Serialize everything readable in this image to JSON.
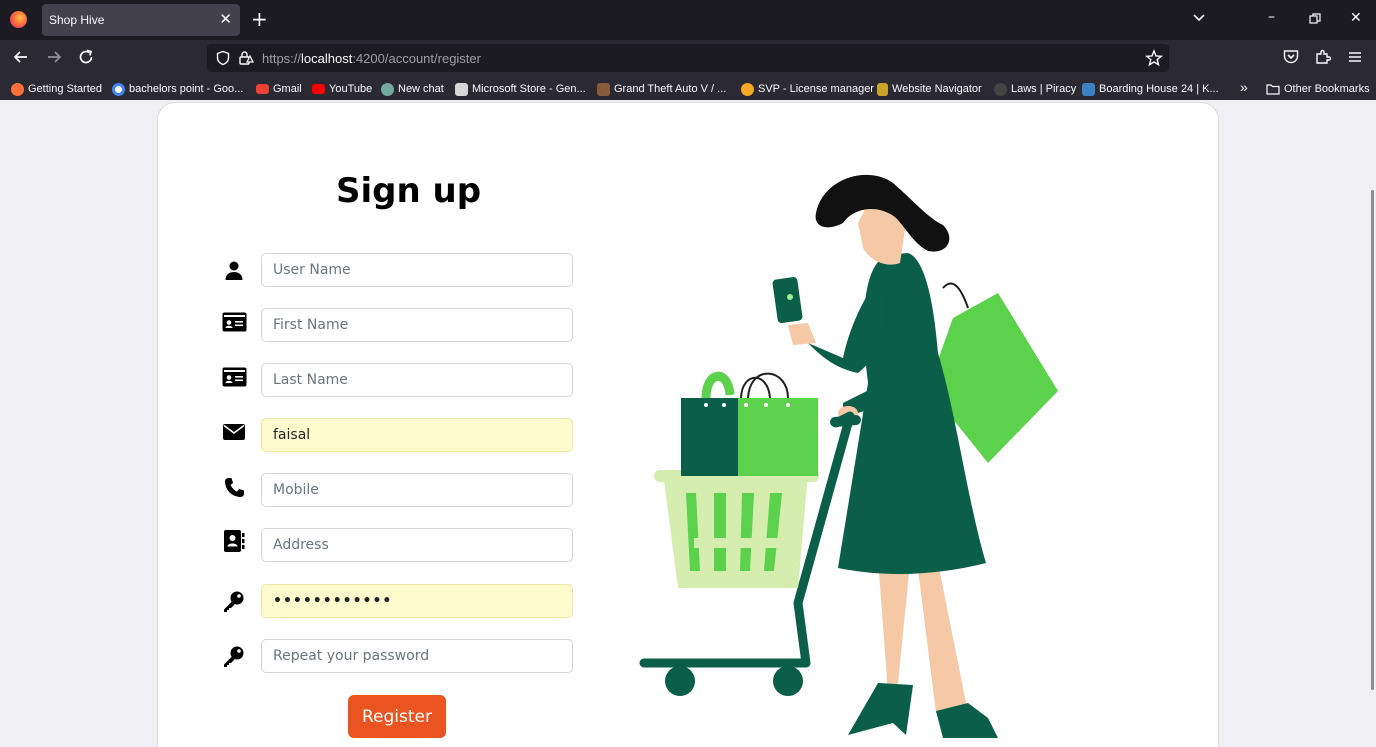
{
  "browser": {
    "tab_title": "Shop Hive",
    "url_prefix": "https://",
    "url_host": "localhost",
    "url_rest": ":4200/account/register"
  },
  "bookmarks": [
    {
      "label": "Getting Started",
      "color": "#ff7139"
    },
    {
      "label": "bachelors point - Goo...",
      "color": "#4285f4"
    },
    {
      "label": "Gmail",
      "color": "#ea4335"
    },
    {
      "label": "YouTube",
      "color": "#ff0000"
    },
    {
      "label": "New chat",
      "color": "#74aa9c"
    },
    {
      "label": "Microsoft Store - Gen...",
      "color": "#d6d6d6"
    },
    {
      "label": "Grand Theft Auto V / ...",
      "color": "#8a5a3c"
    },
    {
      "label": "SVP - License manager",
      "color": "#f4a825"
    },
    {
      "label": "Website Navigator",
      "color": "#c9a227"
    },
    {
      "label": "Laws | Piracy",
      "color": "#444444"
    },
    {
      "label": "Boarding House 24 | K...",
      "color": "#3b82c4"
    }
  ],
  "other_bookmarks": "Other Bookmarks",
  "form": {
    "title": "Sign up",
    "fields": [
      {
        "icon": "user-icon",
        "placeholder": "User Name",
        "value": ""
      },
      {
        "icon": "id-card-icon",
        "placeholder": "First Name",
        "value": ""
      },
      {
        "icon": "id-card-icon",
        "placeholder": "Last Name",
        "value": ""
      },
      {
        "icon": "envelope-icon",
        "placeholder": "",
        "value": "faisal"
      },
      {
        "icon": "phone-icon",
        "placeholder": "Mobile",
        "value": ""
      },
      {
        "icon": "address-book-icon",
        "placeholder": "Address",
        "value": ""
      },
      {
        "icon": "key-icon",
        "placeholder": "",
        "value": "••••••••••••"
      },
      {
        "icon": "key-icon",
        "placeholder": "Repeat your password",
        "value": ""
      }
    ],
    "register_label": "Register"
  },
  "colors": {
    "accent": "#e95420",
    "autofill": "#fffacd",
    "dark_green": "#0b5e47",
    "light_green": "#5cd14b"
  }
}
